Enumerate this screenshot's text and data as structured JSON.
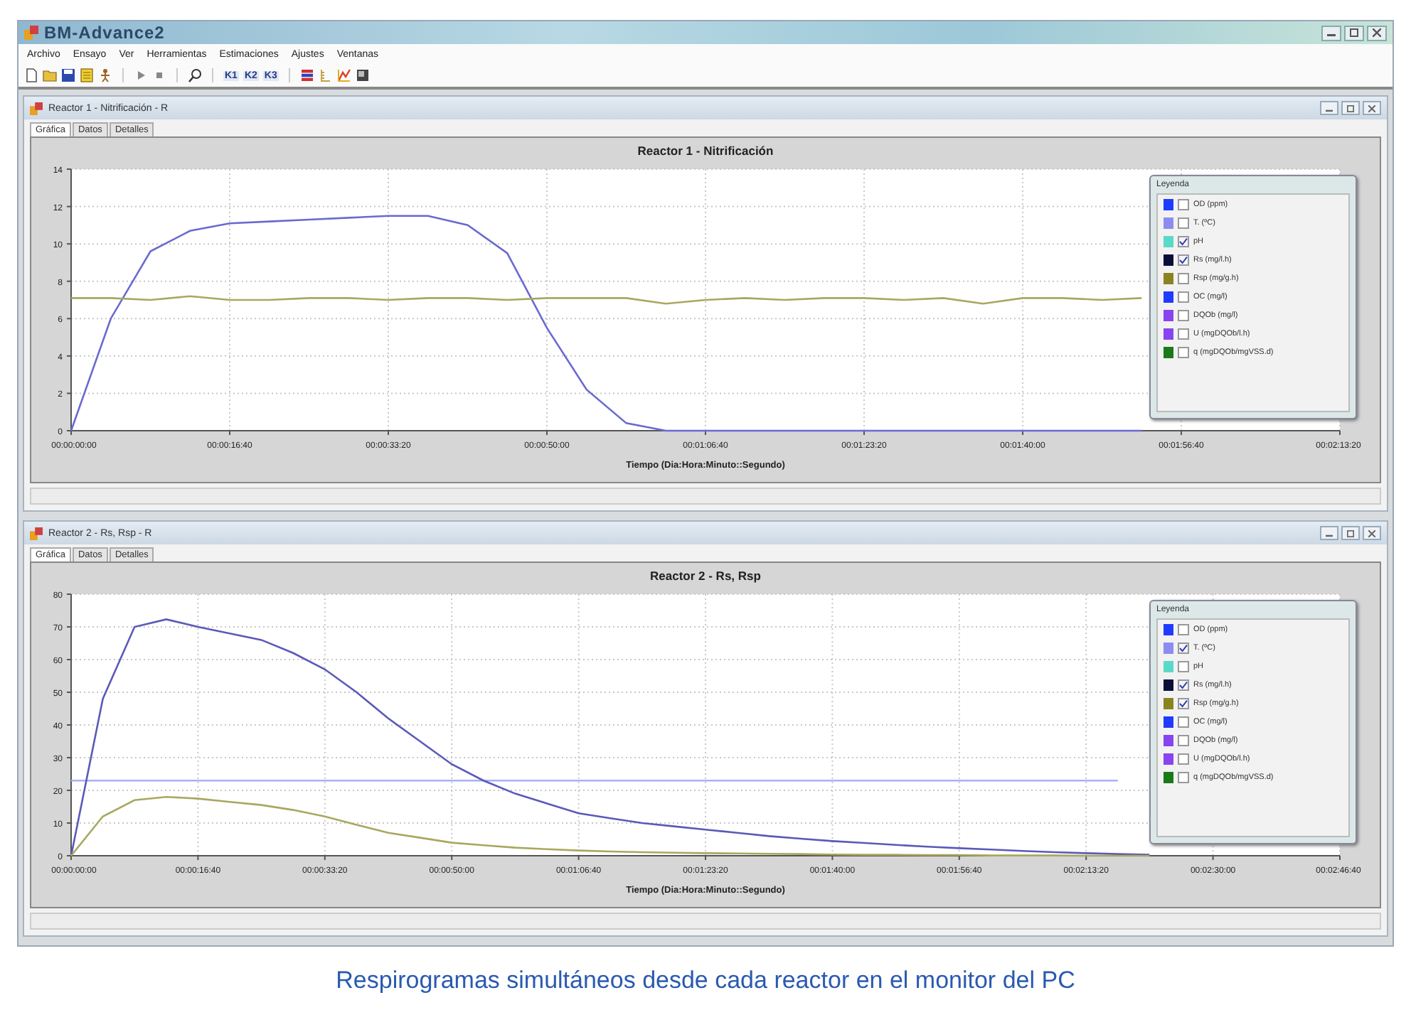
{
  "window": {
    "title": "BM-Advance2"
  },
  "menu": [
    "Archivo",
    "Ensayo",
    "Ver",
    "Herramientas",
    "Estimaciones",
    "Ajustes",
    "Ventanas"
  ],
  "toolbar_labels": [
    "K1",
    "K2",
    "K3"
  ],
  "child_windows": [
    {
      "title": "Reactor 1 - Nitrificación - R",
      "tabs": [
        {
          "label": "Gráfica",
          "selected": true
        },
        {
          "label": "Datos",
          "selected": false
        },
        {
          "label": "Detalles",
          "selected": false
        }
      ],
      "chart_data": {
        "type": "line",
        "title": "Reactor 1 - Nitrificación",
        "xlabel": "Tiempo (Dia:Hora:Minuto::Segundo)",
        "categories": [
          "00:00:00:00",
          null,
          null,
          null,
          "00:00:16:40",
          null,
          null,
          null,
          "00:00:33:20",
          null,
          null,
          null,
          "00:00:50:00",
          null,
          null,
          null,
          "00:01:06:40",
          null,
          null,
          null,
          "00:01:23:20",
          null,
          null,
          null,
          "00:01:40:00",
          null,
          null,
          null,
          "00:01:56:40",
          null,
          null,
          null,
          "00:02:13:20"
        ],
        "ylim": [
          0,
          14
        ],
        "grid": true,
        "yticks": [
          0,
          2,
          4,
          6,
          8,
          10,
          12,
          14
        ],
        "series": [
          {
            "color": "#6a6ad0",
            "values": [
              0,
              6,
              9.6,
              10.7,
              11.1,
              11.2,
              11.3,
              11.4,
              11.5,
              11.5,
              11.0,
              9.5,
              5.5,
              2.2,
              0.4,
              0,
              0,
              0,
              0,
              0,
              0,
              0,
              0,
              0,
              0,
              0,
              0,
              0,
              null,
              null,
              null,
              null,
              null
            ]
          },
          {
            "color": "#a8a860",
            "values": [
              7.1,
              7.1,
              7.0,
              7.2,
              7.0,
              7.0,
              7.1,
              7.1,
              7.0,
              7.1,
              7.1,
              7.0,
              7.1,
              7.1,
              7.1,
              6.8,
              7.0,
              7.1,
              7.0,
              7.1,
              7.1,
              7.0,
              7.1,
              6.8,
              7.1,
              7.1,
              7.0,
              7.1,
              null,
              null,
              null,
              null,
              null
            ]
          }
        ]
      },
      "legend": {
        "title": "Leyenda",
        "items": [
          {
            "label": "OD (ppm)",
            "color": "#1f3bff",
            "checked": false
          },
          {
            "label": "T. (ºC)",
            "color": "#8c8cf0",
            "checked": false
          },
          {
            "label": "pH",
            "color": "#5ad9c8",
            "checked": true
          },
          {
            "label": "Rs (mg/l.h)",
            "color": "#0a0f3a",
            "checked": true
          },
          {
            "label": "Rsp (mg/g.h)",
            "color": "#8a8420",
            "checked": false
          },
          {
            "label": "OC (mg/l)",
            "color": "#1f3bff",
            "checked": false
          },
          {
            "label": "DQOb (mg/l)",
            "color": "#8844ee",
            "checked": false
          },
          {
            "label": "U (mgDQOb/l.h)",
            "color": "#8844ee",
            "checked": false
          },
          {
            "label": "q (mgDQOb/mgVSS.d)",
            "color": "#1a7a1a",
            "checked": false
          }
        ]
      }
    },
    {
      "title": "Reactor 2 - Rs, Rsp - R",
      "tabs": [
        {
          "label": "Gráfica",
          "selected": true
        },
        {
          "label": "Datos",
          "selected": false
        },
        {
          "label": "Detalles",
          "selected": false
        }
      ],
      "chart_data": {
        "type": "line",
        "title": "Reactor 2 - Rs, Rsp",
        "xlabel": "Tiempo (Dia:Hora:Minuto::Segundo)",
        "categories": [
          "00:00:00:00",
          null,
          null,
          null,
          "00:00:16:40",
          null,
          null,
          null,
          "00:00:33:20",
          null,
          null,
          null,
          "00:00:50:00",
          null,
          null,
          null,
          "00:01:06:40",
          null,
          null,
          null,
          "00:01:23:20",
          null,
          null,
          null,
          "00:01:40:00",
          null,
          null,
          null,
          "00:01:56:40",
          null,
          null,
          null,
          "00:02:13:20",
          null,
          null,
          null,
          "00:02:30:00",
          null,
          null,
          null,
          "00:02:46:40"
        ],
        "ylim": [
          0,
          80
        ],
        "grid": true,
        "yticks": [
          0,
          10,
          20,
          30,
          40,
          50,
          60,
          70,
          80
        ],
        "series": [
          {
            "color": "#a8b0f4",
            "values": [
              23,
              23,
              23,
              23,
              23,
              23,
              23,
              23,
              23,
              23,
              23,
              23,
              23,
              23,
              23,
              23,
              23,
              23,
              23,
              23,
              23,
              23,
              23,
              23,
              23,
              23,
              23,
              23,
              23,
              23,
              23,
              23,
              23,
              23,
              null,
              null,
              null,
              null,
              null,
              null,
              null
            ]
          },
          {
            "color": "#5a5ab8",
            "values": [
              0,
              48,
              70,
              72.3,
              70,
              68,
              66,
              62,
              57,
              50,
              42,
              35,
              28,
              23,
              19,
              16,
              13,
              11.5,
              10,
              9,
              8,
              7,
              6,
              5.2,
              4.5,
              3.9,
              3.3,
              2.8,
              2.3,
              1.9,
              1.5,
              1.1,
              0.8,
              0.5,
              0.3,
              null,
              null,
              null,
              null,
              null,
              null
            ]
          },
          {
            "color": "#a8a860",
            "values": [
              0,
              12,
              17,
              18,
              17.5,
              16.5,
              15.5,
              14,
              12,
              9.5,
              7,
              5.5,
              4,
              3.2,
              2.5,
              2,
              1.6,
              1.3,
              1.1,
              0.9,
              0.8,
              0.7,
              0.6,
              0.5,
              0.4,
              0.3,
              0.3,
              0.2,
              0.2,
              0.1,
              0.1,
              0.1,
              0,
              0,
              0,
              null,
              null,
              null,
              null,
              null,
              null
            ]
          }
        ]
      },
      "legend": {
        "title": "Leyenda",
        "items": [
          {
            "label": "OD (ppm)",
            "color": "#1f3bff",
            "checked": false
          },
          {
            "label": "T. (ºC)",
            "color": "#8c8cf0",
            "checked": true
          },
          {
            "label": "pH",
            "color": "#5ad9c8",
            "checked": false
          },
          {
            "label": "Rs (mg/l.h)",
            "color": "#0a0f3a",
            "checked": true
          },
          {
            "label": "Rsp (mg/g.h)",
            "color": "#8a8420",
            "checked": true
          },
          {
            "label": "OC (mg/l)",
            "color": "#1f3bff",
            "checked": false
          },
          {
            "label": "DQOb (mg/l)",
            "color": "#8844ee",
            "checked": false
          },
          {
            "label": "U (mgDQOb/l.h)",
            "color": "#8844ee",
            "checked": false
          },
          {
            "label": "q (mgDQOb/mgVSS.d)",
            "color": "#1a7a1a",
            "checked": false
          }
        ]
      }
    }
  ],
  "caption": "Respirogramas simultáneos desde cada reactor en el monitor del PC"
}
